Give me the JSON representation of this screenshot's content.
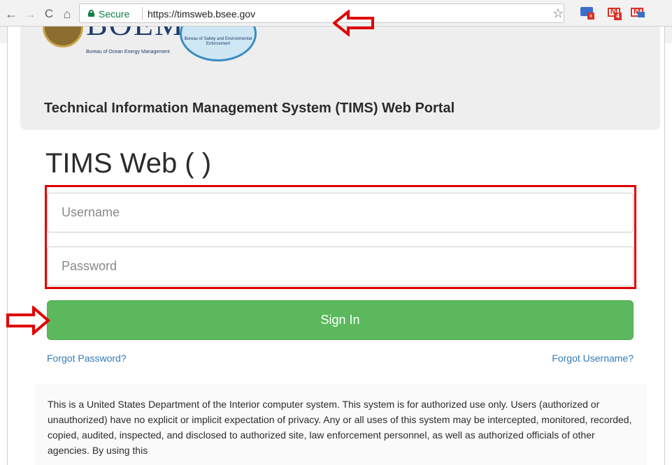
{
  "browser": {
    "nav": {
      "back_icon": "arrow-left-icon",
      "forward_icon": "arrow-right-icon",
      "reload_icon": "reload-icon",
      "home_icon": "home-icon"
    },
    "security_label": "Secure",
    "url": "https://timsweb.bsee.gov",
    "extensions": [
      "screen-share-extension-icon",
      "gmail-checker-icon",
      "gmail-notifier-icon"
    ],
    "gmail_badge": "4"
  },
  "header": {
    "logo_left_text": "BOEM",
    "logo_left_subtitle": "Bureau of Ocean Energy Management",
    "logo_right_text": "Bureau of Safety and Environmental Enforcement",
    "portal_title": "Technical Information Management System (TIMS) Web Portal"
  },
  "login": {
    "heading": "TIMS Web ( )",
    "username_placeholder": "Username",
    "password_placeholder": "Password",
    "signin_label": "Sign In",
    "forgot_password": "Forgot Password?",
    "forgot_username": "Forgot Username?"
  },
  "notice": {
    "text": "This is a United States Department of the Interior computer system. This system is for authorized use only. Users (authorized or unauthorized) have no explicit or implicit expectation of privacy. Any or all uses of this system may be intercepted, monitored, recorded, copied, audited, inspected, and disclosed to authorized site, law enforcement personnel, as well as authorized officials of other agencies. By using this"
  },
  "colors": {
    "secure_green": "#0b8043",
    "signin_green": "#5cb85c",
    "link_blue": "#337ab7",
    "annotation_red": "#e00000",
    "header_gray": "#eeeeee"
  }
}
